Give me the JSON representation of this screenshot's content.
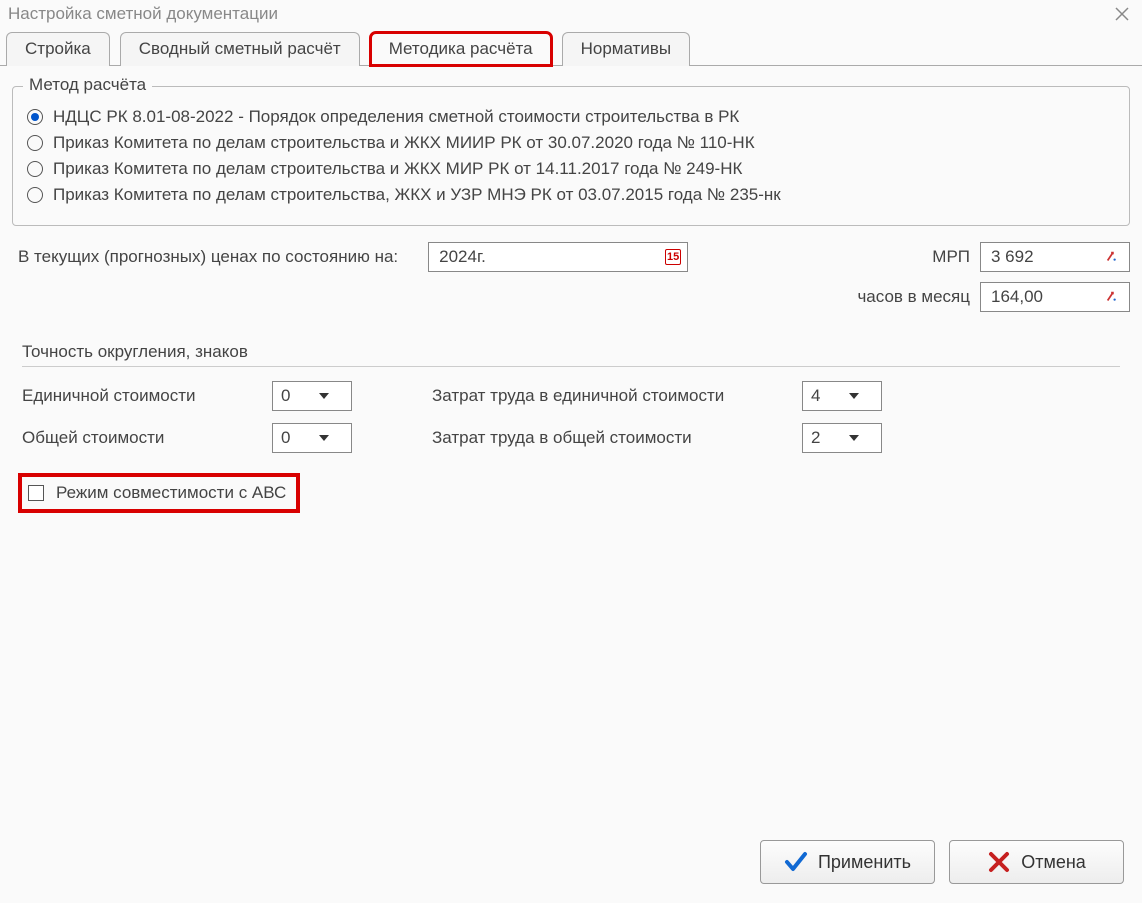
{
  "window": {
    "title": "Настройка сметной документации"
  },
  "tabs": {
    "t0": "Стройка",
    "t1": "Сводный сметный расчёт",
    "t2": "Методика расчёта",
    "t3": "Нормативы"
  },
  "method": {
    "legend": "Метод расчёта",
    "opt0": "НДЦС РК 8.01-08-2022 - Порядок определения сметной стоимости строительства в РК",
    "opt1": "Приказ Комитета по делам строительства и ЖКХ МИИР РК от 30.07.2020 года № 110-НК",
    "opt2": "Приказ Комитета по делам строительства и ЖКХ МИР РК от 14.11.2017 года № 249-НК",
    "opt3": "Приказ Комитета по делам строительства, ЖКХ и УЗР МНЭ РК от 03.07.2015 года № 235-нк"
  },
  "price": {
    "label": "В текущих (прогнозных) ценах по состоянию на:",
    "value": "2024г.",
    "mrp_label": "МРП",
    "mrp_value": "3 692",
    "hours_label": "часов в месяц",
    "hours_value": "164,00"
  },
  "rounding": {
    "title": "Точность округления, знаков",
    "unit_cost_label": "Единичной стоимости",
    "unit_cost_value": "0",
    "total_cost_label": "Общей стоимости",
    "total_cost_value": "0",
    "labor_unit_label": "Затрат труда в единичной стоимости",
    "labor_unit_value": "4",
    "labor_total_label": "Затрат труда в общей стоимости",
    "labor_total_value": "2"
  },
  "abc": {
    "label": "Режим совместимости с АВС"
  },
  "buttons": {
    "apply": "Применить",
    "cancel": "Отмена"
  },
  "icons": {
    "calendar_text": "15"
  }
}
